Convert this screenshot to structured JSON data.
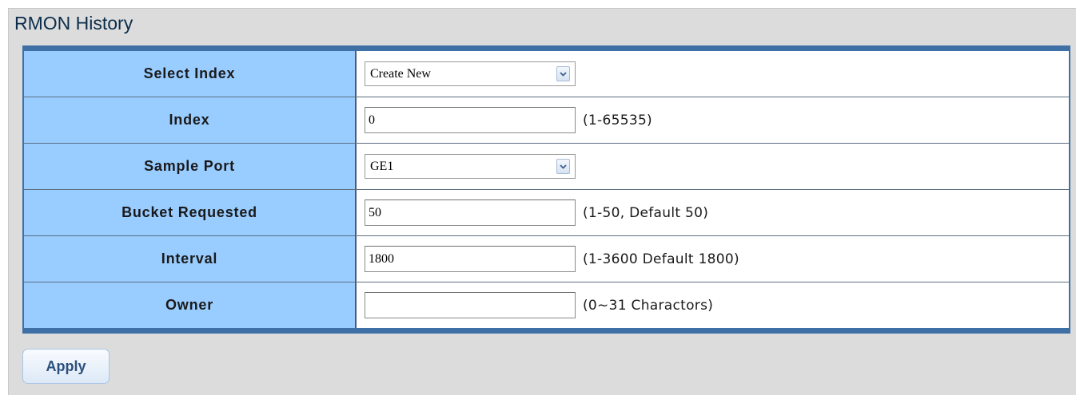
{
  "page": {
    "title": "RMON History"
  },
  "form": {
    "rows": [
      {
        "label": "Select Index",
        "type": "select",
        "value": "Create New",
        "hint": ""
      },
      {
        "label": "Index",
        "type": "text",
        "value": "0",
        "hint": "(1-65535)"
      },
      {
        "label": "Sample Port",
        "type": "select",
        "value": "GE1",
        "hint": ""
      },
      {
        "label": "Bucket Requested",
        "type": "text",
        "value": "50",
        "hint": "(1-50, Default 50)"
      },
      {
        "label": "Interval",
        "type": "text",
        "value": "1800",
        "hint": "(1-3600 Default 1800)"
      },
      {
        "label": "Owner",
        "type": "text",
        "value": "",
        "hint": "(0~31 Charactors)"
      }
    ]
  },
  "actions": {
    "apply_label": "Apply"
  },
  "colors": {
    "label_cell_bg": "#99ccff",
    "table_border": "#3e6fa5",
    "panel_bg": "#dcdcdc",
    "title_color": "#0c2d4c"
  }
}
